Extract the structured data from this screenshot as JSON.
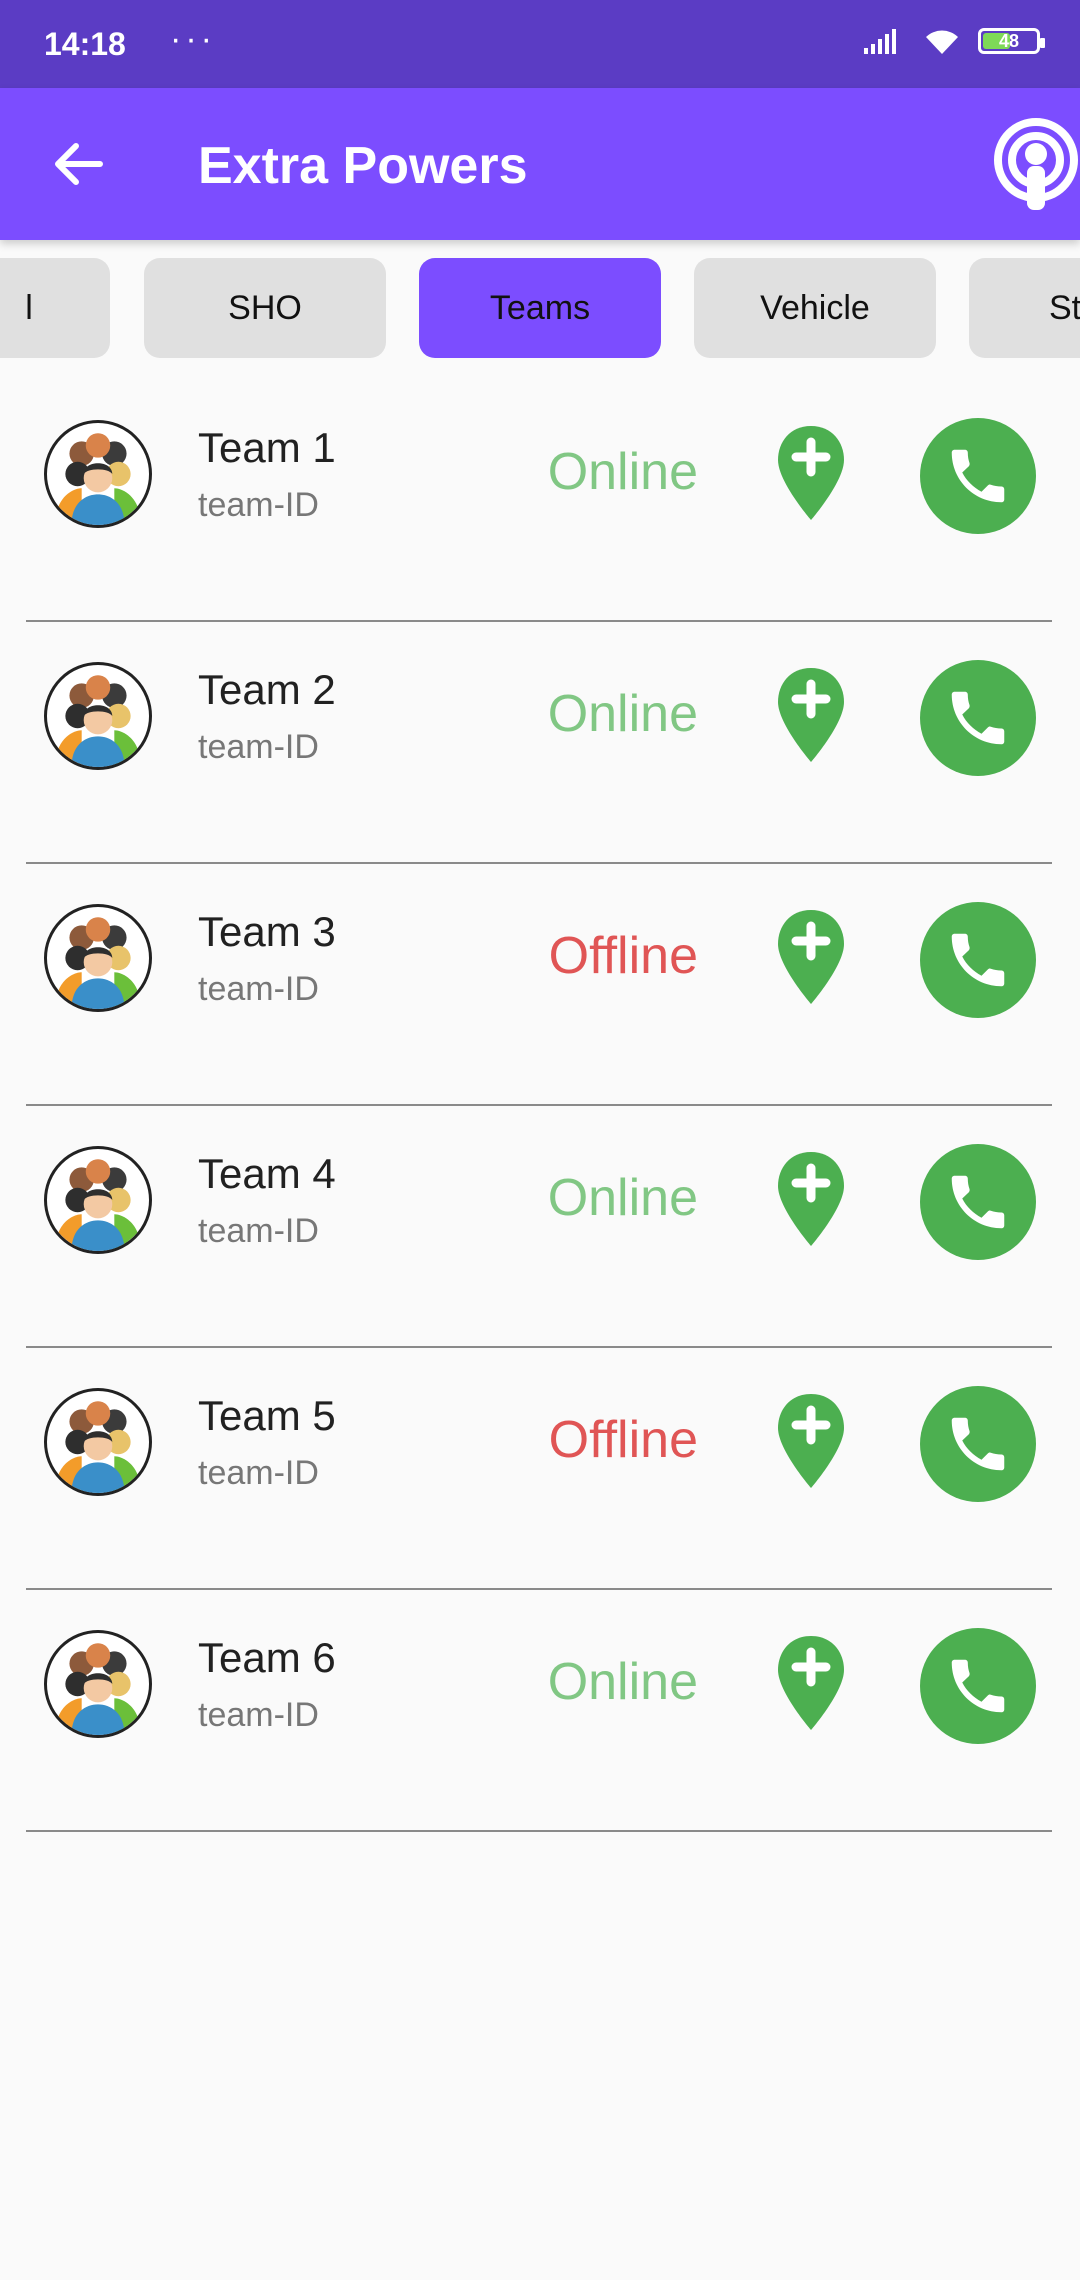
{
  "status_bar": {
    "time": "14:18",
    "dots": "···",
    "battery": "48"
  },
  "app_bar": {
    "title": "Extra Powers",
    "back_icon": "arrow-left-icon",
    "action_icon": "podcast-icon"
  },
  "tabs": [
    {
      "label": "l",
      "active": false
    },
    {
      "label": "SHO",
      "active": false
    },
    {
      "label": "Teams",
      "active": true
    },
    {
      "label": "Vehicle",
      "active": false
    },
    {
      "label": "St",
      "active": false
    }
  ],
  "teams": [
    {
      "name": "Team 1",
      "id": "team-ID",
      "status": "Online"
    },
    {
      "name": "Team 2",
      "id": "team-ID",
      "status": "Online"
    },
    {
      "name": "Team 3",
      "id": "team-ID",
      "status": "Offline"
    },
    {
      "name": "Team 4",
      "id": "team-ID",
      "status": "Online"
    },
    {
      "name": "Team 5",
      "id": "team-ID",
      "status": "Offline"
    },
    {
      "name": "Team 6",
      "id": "team-ID",
      "status": "Online"
    }
  ],
  "colors": {
    "status_bar": "#5b3cc4",
    "app_bar": "#7c4dff",
    "online": "#81c784",
    "offline": "#e05555",
    "action_green": "#4caf50"
  }
}
